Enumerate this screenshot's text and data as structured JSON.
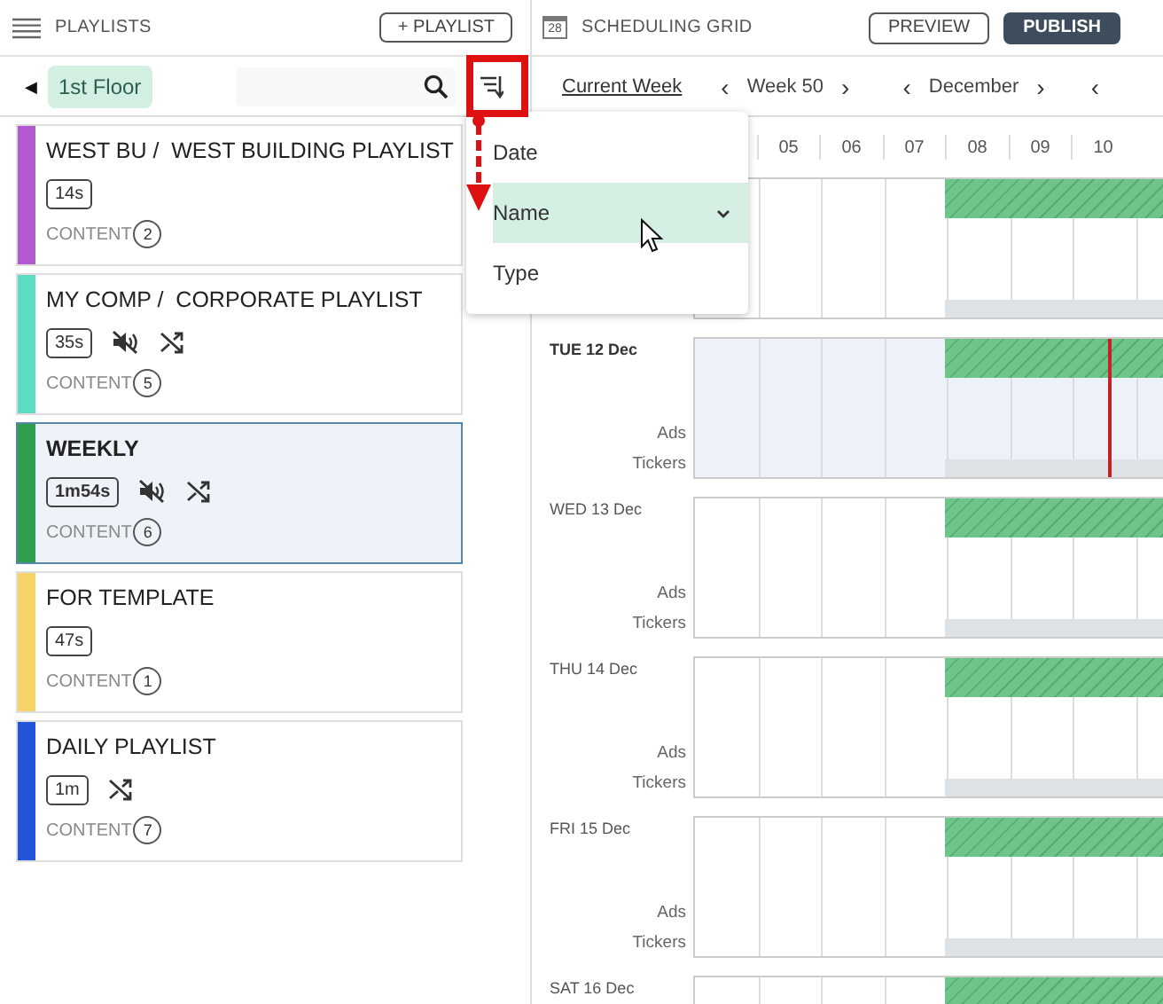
{
  "playlists_panel": {
    "title": "PLAYLISTS",
    "add_button": "+ PLAYLIST",
    "back_button": "◀",
    "location_chip": "1st Floor"
  },
  "sort_menu": {
    "open": true,
    "items": [
      {
        "label": "Date",
        "selected": false
      },
      {
        "label": "Name",
        "selected": true
      },
      {
        "label": "Type",
        "selected": false
      }
    ]
  },
  "playlists": [
    {
      "title": "WEST BU /  WEST BUILDING PLAYLIST",
      "color": "#b259cf",
      "duration": "14s",
      "muted": false,
      "shuffle": false,
      "content_label": "CONTENT",
      "content_count": "2",
      "selected": false
    },
    {
      "title": "MY COMP /  CORPORATE PLAYLIST",
      "color": "#5ddcc4",
      "duration": "35s",
      "muted": true,
      "shuffle": true,
      "content_label": "CONTENT",
      "content_count": "5",
      "selected": false
    },
    {
      "title": "WEEKLY",
      "color": "#2e9e4f",
      "duration": "1m54s",
      "muted": true,
      "shuffle": true,
      "content_label": "CONTENT",
      "content_count": "6",
      "selected": true
    },
    {
      "title": "FOR TEMPLATE",
      "color": "#f6d46a",
      "duration": "47s",
      "muted": false,
      "shuffle": false,
      "content_label": "CONTENT",
      "content_count": "1",
      "selected": false
    },
    {
      "title": "DAILY PLAYLIST",
      "color": "#2255d6",
      "duration": "1m",
      "muted": false,
      "shuffle": true,
      "content_label": "CONTENT",
      "content_count": "7",
      "selected": false
    }
  ],
  "schedule": {
    "title": "SCHEDULING GRID",
    "calendar_day": "28",
    "preview_button": "PREVIEW",
    "publish_button": "PUBLISH",
    "current_week_link": "Current Week",
    "week_nav": {
      "prev": "‹",
      "label": "Week 50",
      "next": "›"
    },
    "month_nav": {
      "prev": "‹",
      "label": "December",
      "next": "›"
    },
    "year_nav": {
      "prev": "‹"
    },
    "hours": [
      {
        "label": "05",
        "current": false
      },
      {
        "label": "06",
        "current": false
      },
      {
        "label": "07",
        "current": false
      },
      {
        "label": "08",
        "current": false
      },
      {
        "label": "09",
        "current": false
      },
      {
        "label": "10",
        "current": false
      }
    ],
    "now_line": {
      "level": 0.82
    },
    "days": [
      {
        "today": false
      },
      {
        "label": "TUE 12 Dec",
        "today": true,
        "tracks": [
          "Ads",
          "Tickers"
        ]
      },
      {
        "label": "WED 13 Dec",
        "today": false,
        "tracks": [
          "Ads",
          "Tickers"
        ]
      },
      {
        "label": "THU 14 Dec",
        "today": false,
        "tracks": [
          "Ads",
          "Tickers"
        ]
      },
      {
        "label": "FRI 15 Dec",
        "today": false,
        "tracks": [
          "Ads",
          "Tickers"
        ]
      },
      {
        "label": "SAT 16 Dec",
        "today": false
      }
    ]
  }
}
